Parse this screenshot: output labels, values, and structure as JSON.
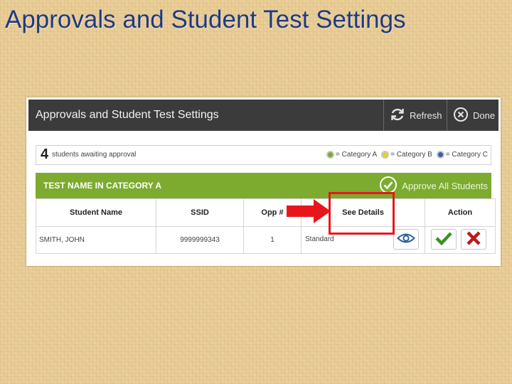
{
  "slide": {
    "title": "Approvals and Student Test Settings"
  },
  "window": {
    "title": "Approvals and Student Test Settings",
    "refresh_label": "Refresh",
    "done_label": "Done"
  },
  "summary": {
    "count": "4",
    "count_text": "students awaiting approval",
    "legend": [
      {
        "label": "= Category A",
        "color": "#7cab2f"
      },
      {
        "label": "= Category B",
        "color": "#e2d12a"
      },
      {
        "label": "= Category C",
        "color": "#3a5fa8"
      }
    ]
  },
  "test_group": {
    "name": "TEST NAME IN CATEGORY A",
    "approve_all_label": "Approve All Students"
  },
  "table": {
    "headers": [
      "Student Name",
      "SSID",
      "Opp #",
      "See Details",
      "Action"
    ],
    "rows": [
      {
        "name": "SMITH, JOHN",
        "ssid": "9999999343",
        "opp": "1",
        "details": "Standard"
      }
    ]
  },
  "colors": {
    "title_text": "#1f3a80",
    "titlebar_bg": "#3b3b3b",
    "green_bar": "#7cab2f",
    "approve_check": "#3f8f24",
    "deny_x": "#b81c1c",
    "eye_icon": "#2e5e9e",
    "highlight": "#e8161b"
  },
  "icons": {
    "refresh": "refresh-icon",
    "done": "close-circle-icon",
    "approve_all": "check-circle-icon",
    "details": "eye-icon",
    "approve": "checkmark-icon",
    "deny": "x-icon",
    "callout": "arrow-right-icon"
  }
}
